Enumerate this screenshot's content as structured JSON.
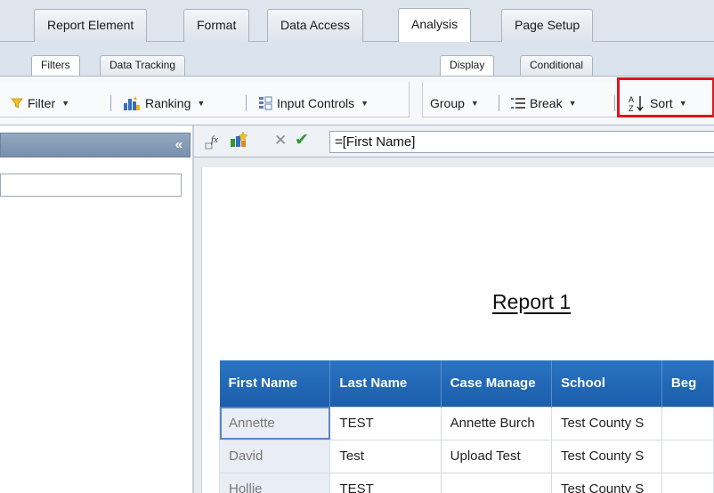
{
  "top_tabs": [
    "Report Element",
    "Format",
    "Data Access",
    "Analysis",
    "Page Setup"
  ],
  "active_top_tab": "Analysis",
  "sub_tabs_left": [
    "Filters",
    "Data Tracking"
  ],
  "sub_tabs_right": [
    "Display",
    "Conditional"
  ],
  "toolbar": {
    "filter_label": "Filter",
    "ranking_label": "Ranking",
    "input_controls_label": "Input Controls",
    "group_label": "Group",
    "break_label": "Break",
    "sort_label": "Sort"
  },
  "left_panel": {
    "collapse_glyph": "«"
  },
  "formula": {
    "value": "=[First Name]"
  },
  "report": {
    "title": "Report 1",
    "columns": [
      "First Name",
      "Last Name",
      "Case Manage",
      "School",
      "Beg"
    ],
    "rows": [
      [
        "Annette",
        "TEST",
        "Annette Burch",
        "Test County S",
        ""
      ],
      [
        "David",
        "Test",
        "Upload Test",
        "Test County S",
        ""
      ],
      [
        "Hollie",
        "TEST",
        "",
        "Test County S",
        ""
      ]
    ]
  },
  "colors": {
    "highlight": "#e0141e",
    "header_blue": "#1b5eab",
    "accent_green": "#2e9a2e"
  }
}
